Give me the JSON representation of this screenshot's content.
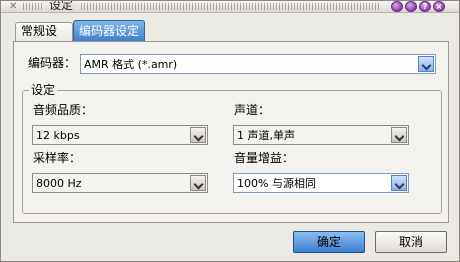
{
  "window": {
    "title": "设定",
    "buttons": [
      "?",
      "×"
    ]
  },
  "tabs": [
    {
      "label": "常规设定",
      "active": false
    },
    {
      "label": "编码器设定",
      "active": true
    }
  ],
  "encoder": {
    "label": "编码器：",
    "value": "AMR 格式 (*.amr)"
  },
  "settings_group": {
    "title": "设定",
    "quality": {
      "label": "音频品质：",
      "value": "12 kbps"
    },
    "channels": {
      "label": "声道：",
      "value": "1 声道,单声"
    },
    "sample_rate": {
      "label": "采样率：",
      "value": "8000 Hz"
    },
    "volume_gain": {
      "label": "音量增益：",
      "value": "100% 与源相同"
    }
  },
  "dialog_buttons": {
    "ok": "确定",
    "cancel": "取消"
  },
  "colors": {
    "accent": "#3e7fcf",
    "title_button": "#8a3fa8",
    "panel": "#f3f2ee"
  }
}
